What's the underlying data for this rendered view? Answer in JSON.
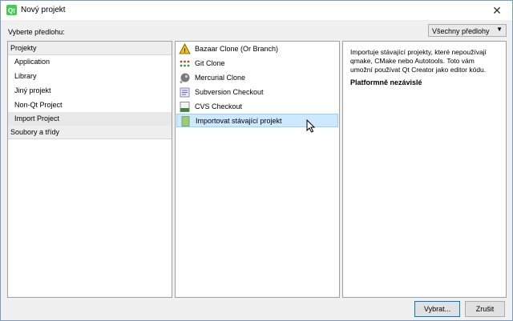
{
  "window": {
    "title": "Nový projekt",
    "close_glyph": "✕",
    "app_icon": "qt-creator-icon"
  },
  "template_label": "Vyberte předlohu:",
  "filter": {
    "selected": "Všechny předlohy",
    "arrow": "▼"
  },
  "categories": {
    "projects_header": "Projekty",
    "items": [
      {
        "label": "Application"
      },
      {
        "label": "Library"
      },
      {
        "label": "Jiný projekt"
      },
      {
        "label": "Non-Qt Project"
      },
      {
        "label": "Import Project"
      }
    ],
    "files_header": "Soubory a třídy"
  },
  "wizards": [
    {
      "label": "Bazaar Clone (Or Branch)",
      "icon": "bazaar-icon"
    },
    {
      "label": "Git Clone",
      "icon": "git-icon"
    },
    {
      "label": "Mercurial Clone",
      "icon": "mercurial-icon"
    },
    {
      "label": "Subversion Checkout",
      "icon": "subversion-icon"
    },
    {
      "label": "CVS Checkout",
      "icon": "cvs-icon"
    },
    {
      "label": "Importovat stávající projekt",
      "icon": "import-project-icon"
    }
  ],
  "description": {
    "text": "Importuje stávající projekty, které nepoužívají qmake, CMake nebo Autotools. Toto vám umožní používat Qt Creator jako editor kódu.",
    "platform": "Platformně nezávislé"
  },
  "buttons": {
    "choose": "Vybrat...",
    "cancel": "Zrušit"
  }
}
